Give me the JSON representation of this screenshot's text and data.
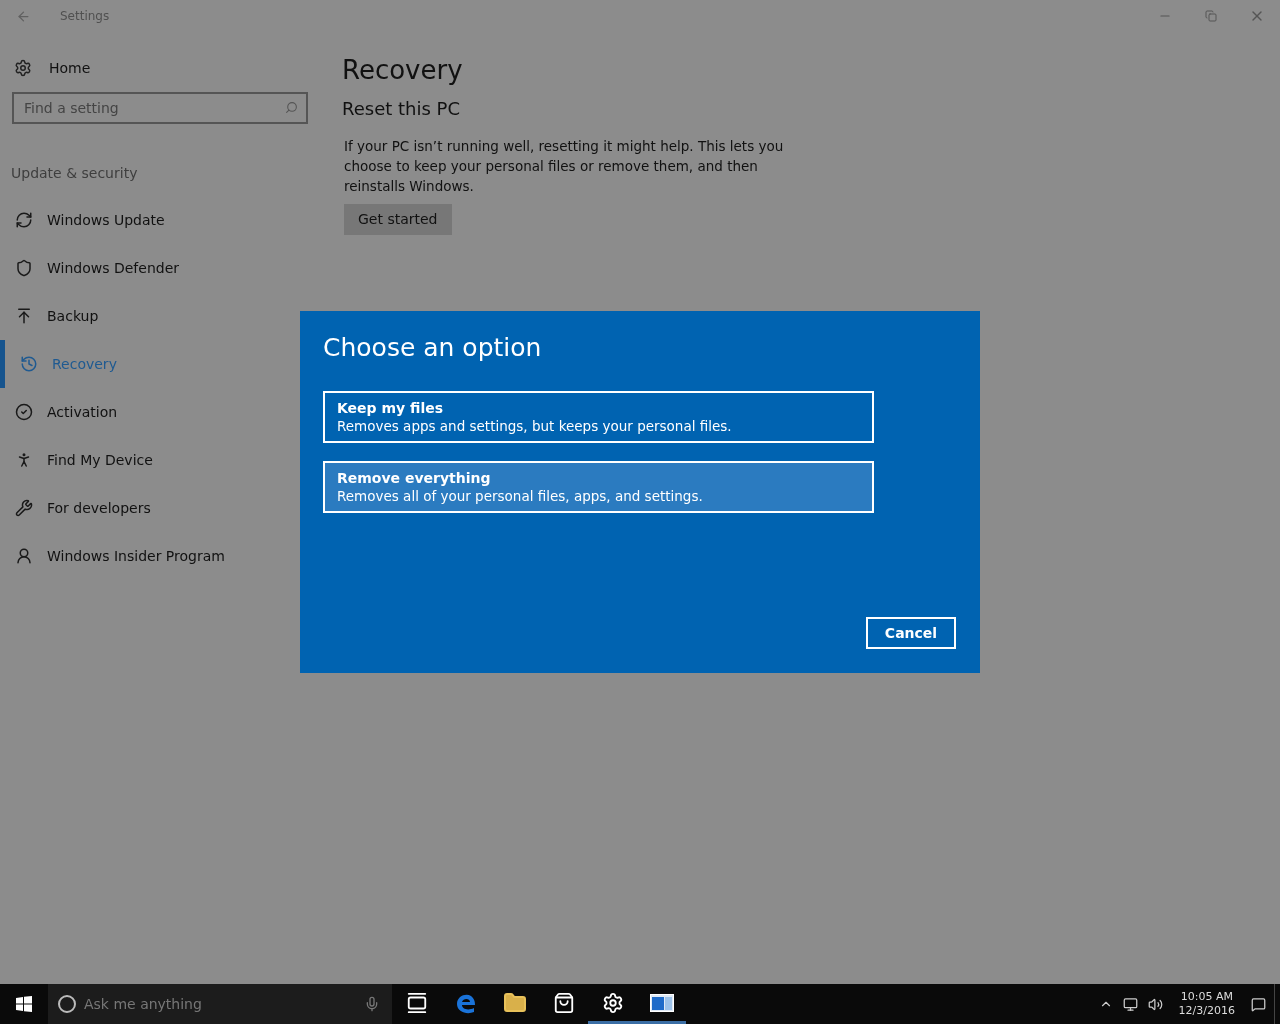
{
  "window": {
    "title": "Settings"
  },
  "sidebar": {
    "home": "Home",
    "search": {
      "placeholder": "Find a setting"
    },
    "section": "Update & security",
    "items": [
      {
        "kind": "update",
        "label": "Windows Update",
        "selected": false
      },
      {
        "kind": "defender",
        "label": "Windows Defender",
        "selected": false
      },
      {
        "kind": "backup",
        "label": "Backup",
        "selected": false
      },
      {
        "kind": "recovery",
        "label": "Recovery",
        "selected": true
      },
      {
        "kind": "activation",
        "label": "Activation",
        "selected": false
      },
      {
        "kind": "find",
        "label": "Find My Device",
        "selected": false
      },
      {
        "kind": "developers",
        "label": "For developers",
        "selected": false
      },
      {
        "kind": "insider",
        "label": "Windows Insider Program",
        "selected": false
      }
    ]
  },
  "content": {
    "title": "Recovery",
    "section": "Reset this PC",
    "description": "If your PC isn’t running well, resetting it might help. This lets you choose to keep your personal files or remove them, and then reinstalls Windows.",
    "button": "Get started"
  },
  "dialog": {
    "title": "Choose an option",
    "options": [
      {
        "title": "Keep my files",
        "description": "Removes apps and settings, but keeps your personal files.",
        "selected": false
      },
      {
        "title": "Remove everything",
        "description": "Removes all of your personal files, apps, and settings.",
        "selected": true
      }
    ],
    "cancel": "Cancel"
  },
  "taskbar": {
    "search": {
      "placeholder": "Ask me anything"
    },
    "apps": [
      {
        "kind": "taskview",
        "open": false
      },
      {
        "kind": "edge",
        "open": false
      },
      {
        "kind": "explorer",
        "open": false
      },
      {
        "kind": "store",
        "open": false
      },
      {
        "kind": "settings",
        "open": true
      },
      {
        "kind": "window",
        "open": true
      }
    ],
    "time": "10:05 AM",
    "date": "12/3/2016"
  }
}
